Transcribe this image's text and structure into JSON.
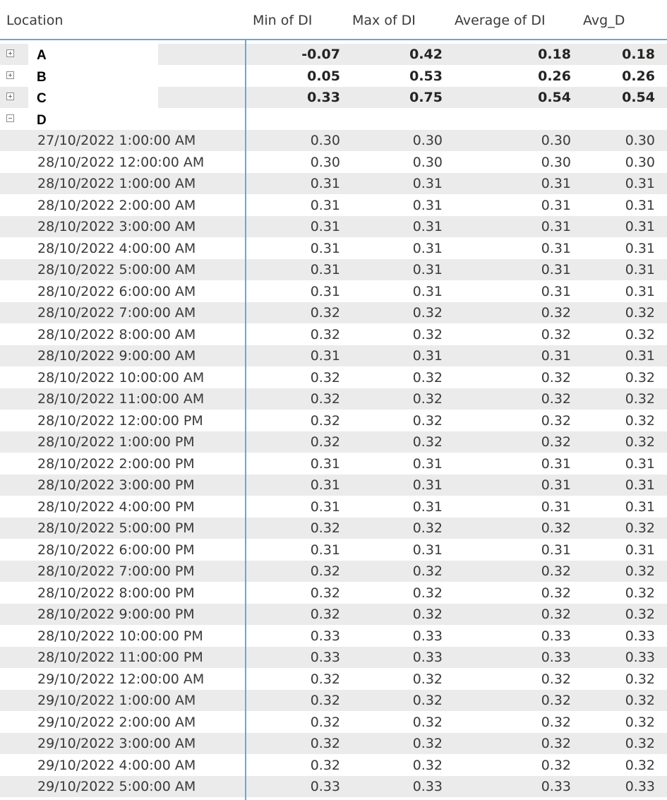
{
  "headers": {
    "location": "Location",
    "min": "Min of DI",
    "max": "Max of DI",
    "average": "Average of DI",
    "avg_d": "Avg_D"
  },
  "groups": [
    {
      "name": "A",
      "expanded": false,
      "min": "-0.07",
      "max": "0.42",
      "average": "0.18",
      "avg_d": "0.18"
    },
    {
      "name": "B",
      "expanded": false,
      "min": "0.05",
      "max": "0.53",
      "average": "0.26",
      "avg_d": "0.26"
    },
    {
      "name": "C",
      "expanded": false,
      "min": "0.33",
      "max": "0.75",
      "average": "0.54",
      "avg_d": "0.54"
    },
    {
      "name": "D",
      "expanded": true,
      "min": "",
      "max": "",
      "average": "",
      "avg_d": ""
    }
  ],
  "rows": [
    {
      "time": "27/10/2022 1:00:00 AM",
      "v": "0.30"
    },
    {
      "time": "28/10/2022 12:00:00 AM",
      "v": "0.30"
    },
    {
      "time": "28/10/2022 1:00:00 AM",
      "v": "0.31"
    },
    {
      "time": "28/10/2022 2:00:00 AM",
      "v": "0.31"
    },
    {
      "time": "28/10/2022 3:00:00 AM",
      "v": "0.31"
    },
    {
      "time": "28/10/2022 4:00:00 AM",
      "v": "0.31"
    },
    {
      "time": "28/10/2022 5:00:00 AM",
      "v": "0.31"
    },
    {
      "time": "28/10/2022 6:00:00 AM",
      "v": "0.31"
    },
    {
      "time": "28/10/2022 7:00:00 AM",
      "v": "0.32"
    },
    {
      "time": "28/10/2022 8:00:00 AM",
      "v": "0.32"
    },
    {
      "time": "28/10/2022 9:00:00 AM",
      "v": "0.31"
    },
    {
      "time": "28/10/2022 10:00:00 AM",
      "v": "0.32"
    },
    {
      "time": "28/10/2022 11:00:00 AM",
      "v": "0.32"
    },
    {
      "time": "28/10/2022 12:00:00 PM",
      "v": "0.32"
    },
    {
      "time": "28/10/2022 1:00:00 PM",
      "v": "0.32"
    },
    {
      "time": "28/10/2022 2:00:00 PM",
      "v": "0.31"
    },
    {
      "time": "28/10/2022 3:00:00 PM",
      "v": "0.31"
    },
    {
      "time": "28/10/2022 4:00:00 PM",
      "v": "0.31"
    },
    {
      "time": "28/10/2022 5:00:00 PM",
      "v": "0.32"
    },
    {
      "time": "28/10/2022 6:00:00 PM",
      "v": "0.31"
    },
    {
      "time": "28/10/2022 7:00:00 PM",
      "v": "0.32"
    },
    {
      "time": "28/10/2022 8:00:00 PM",
      "v": "0.32"
    },
    {
      "time": "28/10/2022 9:00:00 PM",
      "v": "0.32"
    },
    {
      "time": "28/10/2022 10:00:00 PM",
      "v": "0.33"
    },
    {
      "time": "28/10/2022 11:00:00 PM",
      "v": "0.33"
    },
    {
      "time": "29/10/2022 12:00:00 AM",
      "v": "0.32"
    },
    {
      "time": "29/10/2022 1:00:00 AM",
      "v": "0.32"
    },
    {
      "time": "29/10/2022 2:00:00 AM",
      "v": "0.32"
    },
    {
      "time": "29/10/2022 3:00:00 AM",
      "v": "0.32"
    },
    {
      "time": "29/10/2022 4:00:00 AM",
      "v": "0.32"
    },
    {
      "time": "29/10/2022 5:00:00 AM",
      "v": "0.33"
    }
  ],
  "colors": {
    "divider": "#68a7d9",
    "stripe": "#ebebeb",
    "text": "#3b3a39"
  }
}
